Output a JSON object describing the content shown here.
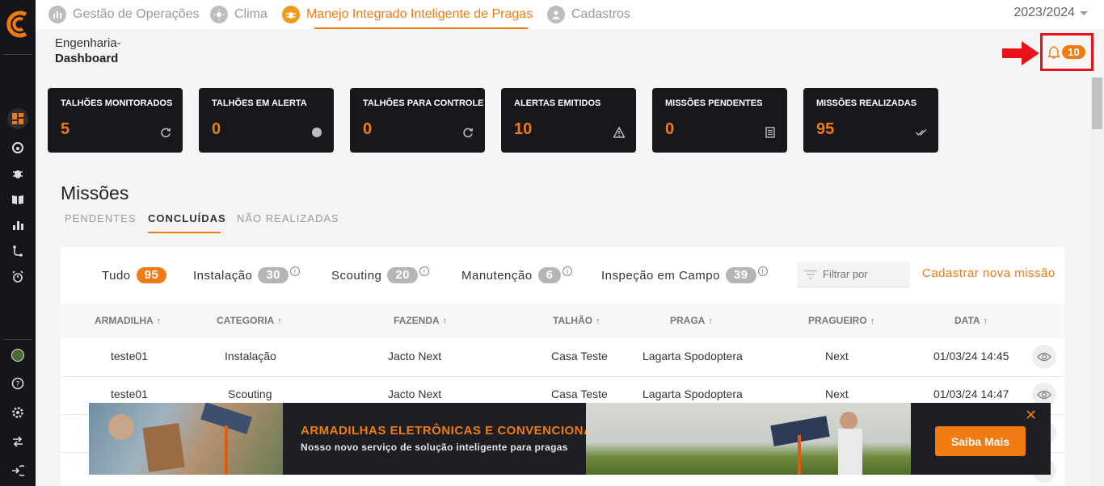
{
  "topnav": {
    "tabs": [
      {
        "label": "Gestão de Operações",
        "icon": "operations-icon"
      },
      {
        "label": "Clima",
        "icon": "sun-icon"
      },
      {
        "label": "Manejo Integrado Inteligente de Pragas",
        "icon": "pest-icon"
      },
      {
        "label": "Cadastros",
        "icon": "user-icon"
      }
    ],
    "season": "2023/2024"
  },
  "breadcrumb": {
    "parent": "Engenharia-",
    "current": "Dashboard"
  },
  "notifications": {
    "count": "10"
  },
  "stats": [
    {
      "label": "TALHÕES MONITORADOS",
      "value": "5",
      "icon": "refresh-icon"
    },
    {
      "label": "TALHÕES EM ALERTA",
      "value": "0",
      "icon": "circle-icon"
    },
    {
      "label": "TALHÕES PARA CONTROLE",
      "value": "0",
      "icon": "refresh-icon"
    },
    {
      "label": "ALERTAS EMITIDOS",
      "value": "10",
      "icon": "warning-icon"
    },
    {
      "label": "MISSÕES PENDENTES",
      "value": "0",
      "icon": "list-icon"
    },
    {
      "label": "MISSÕES REALIZADAS",
      "value": "95",
      "icon": "double-check-icon"
    }
  ],
  "missions": {
    "title": "Missões",
    "tabs": [
      "PENDENTES",
      "CONCLUÍDAS",
      "NÃO REALIZADAS"
    ],
    "filters": [
      {
        "label": "Tudo",
        "count": "95"
      },
      {
        "label": "Instalação",
        "count": "30"
      },
      {
        "label": "Scouting",
        "count": "20"
      },
      {
        "label": "Manutenção",
        "count": "6"
      },
      {
        "label": "Inspeção em Campo",
        "count": "39"
      }
    ],
    "search_placeholder": "Filtrar por",
    "new_mission": "Cadastrar nova missão",
    "columns": [
      "ARMADILHA",
      "CATEGORIA",
      "FAZENDA",
      "TALHÃO",
      "PRAGA",
      "PRAGUEIRO",
      "DATA"
    ],
    "rows": [
      {
        "armadilha": "teste01",
        "categoria": "Instalação",
        "fazenda": "Jacto Next",
        "talhao": "Casa Teste",
        "praga": "Lagarta Spodoptera",
        "pragueiro": "Next",
        "data": "01/03/24 14:45"
      },
      {
        "armadilha": "teste01",
        "categoria": "Scouting",
        "fazenda": "Jacto Next",
        "talhao": "Casa Teste",
        "praga": "Lagarta Spodoptera",
        "pragueiro": "Next",
        "data": "01/03/24 14:47"
      }
    ]
  },
  "banner": {
    "title": "ARMADILHAS ELETRÔNICAS E CONVENCIONAIS",
    "subtitle": "Nosso novo serviço de solução inteligente para pragas",
    "button": "Saiba Mais",
    "close": "✕"
  },
  "colors": {
    "accent": "#f07b13",
    "sidebar": "#15161a",
    "card": "#17181c",
    "highlight": "#e8131a"
  }
}
